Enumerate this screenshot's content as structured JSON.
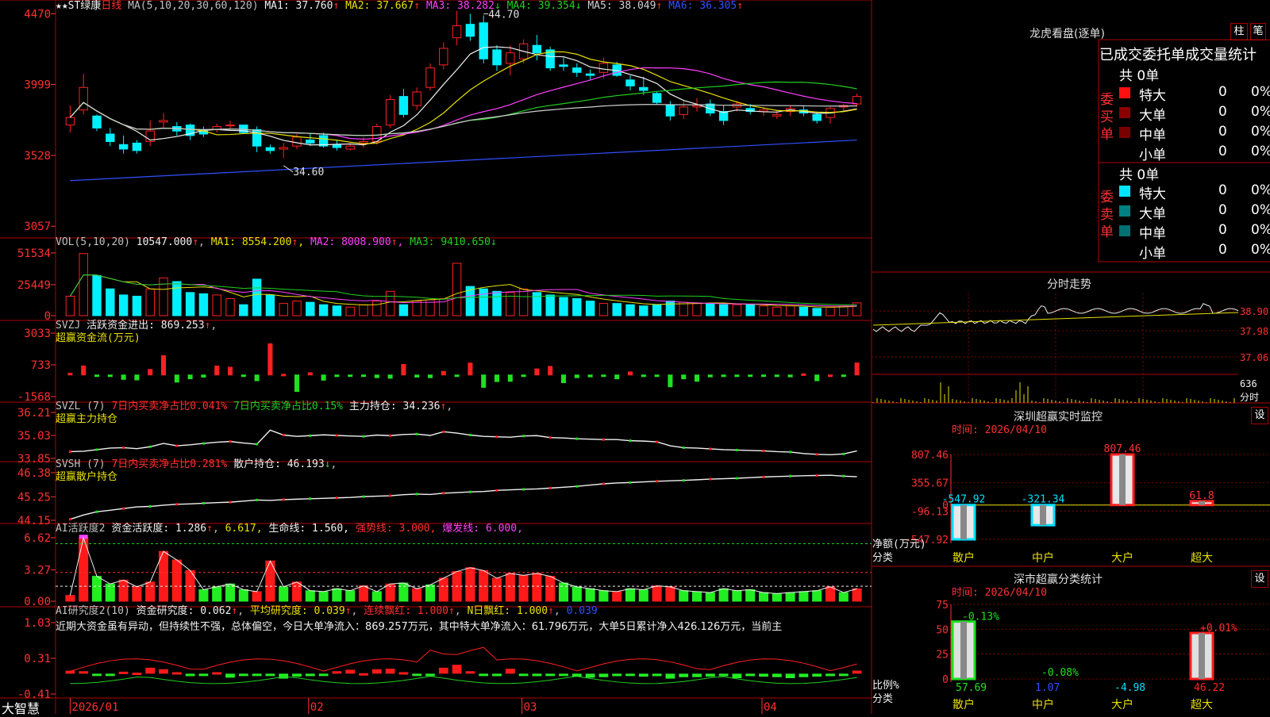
{
  "app": {
    "brand": "大智慧"
  },
  "main": {
    "title_prefix": "★★ST绿康",
    "period": "日线",
    "ma_label": "MA(5,10,20,30,60,120)",
    "ma_values": [
      {
        "name": "MA1:",
        "value": "37.760",
        "arrow": "↑",
        "color": "#f0f0f0"
      },
      {
        "name": "MA2:",
        "value": "37.667",
        "arrow": "↑",
        "color": "#e8e000"
      },
      {
        "name": "MA3:",
        "value": "38.282",
        "arrow": "↓",
        "color": "#ff40ff"
      },
      {
        "name": "MA4:",
        "value": "39.354",
        "arrow": "↓",
        "color": "#20d020"
      },
      {
        "name": "MA5:",
        "value": "38.049",
        "arrow": "↑",
        "color": "#d0d0d0"
      },
      {
        "name": "MA6:",
        "value": "36.305",
        "arrow": "↑",
        "color": "#3050ff"
      }
    ],
    "y_ticks": [
      "4470",
      "3999",
      "3528",
      "3057"
    ],
    "high_label": "44.70",
    "low_label": "34.60"
  },
  "vol": {
    "title": "VOL(5,10,20)",
    "value": "10547.000",
    "ma1": "8554.200",
    "ma2": "8008.900",
    "ma3": "9410.650",
    "y_ticks": [
      "51534",
      "25449",
      "0"
    ]
  },
  "svzj": {
    "title": "SVZJ",
    "label": "活跃资金进出:",
    "value": "869.253",
    "subtitle": "超赢资金流(万元)",
    "y_ticks": [
      "3033",
      "733",
      "-1568"
    ]
  },
  "svzl": {
    "title": "SVZL (7)",
    "t1": "7日内买卖净占比0.041%",
    "t2": "7日内买卖净占比0.15%",
    "t3": "主力持仓: 34.236",
    "subtitle": "超赢主力持仓",
    "y_ticks": [
      "36.21",
      "35.03",
      "33.85"
    ]
  },
  "svsh": {
    "title": "SVSH (7)",
    "t1": "7日内买卖净占比0.281%",
    "t2": "散户持仓: 46.193",
    "subtitle": "超赢散户持仓",
    "y_ticks": [
      "46.38",
      "45.25",
      "44.15"
    ]
  },
  "ai1": {
    "title": "AI活跃度2",
    "t1": "资金活跃度: 1.286",
    "t2": "6.617,",
    "t3": "生命线: 1.560,",
    "t4": "强势线: 3.000,",
    "t5": "爆发线: 6.000,",
    "y_ticks": [
      "6.62",
      "3.27",
      "0.00"
    ]
  },
  "ai2": {
    "title": "AI研究度2(10)",
    "t1": "资金研究度: 0.062",
    "t2": "平均研究度: 0.039",
    "t3": "连续飘红: 1.000",
    "t4": "N日飘红: 1.000",
    "t5": "0.039",
    "comment": "近期大资金虽有异动，但持续性不强，总体偏空，今日大单净流入：869.257万元，其中特大单净流入：61.796万元，大单5日累计净入426.126万元，当前主",
    "y_ticks": [
      "1.03",
      "0.31",
      "-0.41"
    ]
  },
  "x_axis": [
    "2026/01",
    "02",
    "03",
    "04"
  ],
  "right": {
    "lhb_title": "龙虎看盘(逐单)",
    "btn_zhu": "柱",
    "btn_bi": "笔",
    "stats_title": "已成交委托单成交量统计",
    "buy_label": "委买单",
    "sell_label": "委卖单",
    "buy_total": "共 0单",
    "sell_total": "共 0单",
    "rows": [
      {
        "label": "特大",
        "qty": "0",
        "pct": "0%"
      },
      {
        "label": "大单",
        "qty": "0",
        "pct": "0%"
      },
      {
        "label": "中单",
        "qty": "0",
        "pct": "0%"
      },
      {
        "label": "小单",
        "qty": "0",
        "pct": "0%"
      }
    ],
    "intraday_title": "分时走势",
    "intraday_ticks": [
      "38.90",
      "37.98",
      "37.06"
    ],
    "intraday_vol_ticks": [
      "636",
      "分时"
    ],
    "sz_title": "深圳超赢实时监控",
    "sz_btn": "设",
    "sz_time": "时间: 2026/04/10",
    "sz_yticks": [
      "807.46",
      "355.67",
      "0",
      "-96.13",
      "-547.92"
    ],
    "sz_ylabel": "净额(万元)",
    "sz_xlabel": "分类",
    "sz_categories": [
      "散户",
      "中户",
      "大户",
      "超大"
    ],
    "sz_value_labels": [
      "-547.92",
      "-321.34",
      "807.46",
      "61.8"
    ],
    "stat_title": "深市超赢分类统计",
    "stat_btn": "设",
    "stat_time": "时间: 2026/04/10",
    "stat_yticks": [
      "75",
      "50",
      "25",
      "0"
    ],
    "stat_ylabel": "比例%",
    "stat_xlabel": "分类",
    "stat_categories": [
      "散户",
      "中户",
      "大户",
      "超大"
    ],
    "stat_top_labels": [
      "-0.13%",
      "-0.08%",
      "",
      "+0.01%"
    ],
    "stat_bottom_labels": [
      "57.69",
      "1.07",
      "-4.98",
      "46.22"
    ]
  },
  "chart_data": [
    {
      "type": "candlestick",
      "title": "★★ST绿康 日线",
      "ylabel": "",
      "ylim": [
        30.0,
        45.3
      ],
      "note": "prices read from axis (tick 3999 ≈ 40.0)",
      "candles": [
        [
          37.3,
          38.6,
          36.8,
          37.8
        ],
        [
          38.3,
          40.7,
          38.0,
          39.8
        ],
        [
          37.9,
          38.0,
          36.9,
          37.1
        ],
        [
          36.7,
          37.1,
          35.9,
          36.2
        ],
        [
          36.0,
          36.6,
          35.4,
          35.7
        ],
        [
          36.1,
          36.3,
          35.4,
          35.6
        ],
        [
          36.2,
          37.6,
          35.9,
          36.9
        ],
        [
          37.5,
          38.1,
          37.1,
          37.6
        ],
        [
          37.2,
          37.5,
          36.6,
          36.9
        ],
        [
          37.3,
          37.4,
          36.3,
          36.6
        ],
        [
          36.9,
          37.2,
          36.5,
          36.7
        ],
        [
          37.0,
          37.4,
          36.8,
          37.2
        ],
        [
          37.3,
          37.6,
          37.0,
          37.3
        ],
        [
          37.3,
          37.3,
          36.7,
          36.8
        ],
        [
          37.0,
          37.2,
          35.5,
          35.9
        ],
        [
          35.8,
          36.0,
          35.4,
          35.6
        ],
        [
          35.7,
          36.1,
          35.1,
          35.8
        ],
        [
          35.9,
          36.7,
          35.7,
          36.5
        ],
        [
          36.3,
          36.7,
          35.9,
          36.1
        ],
        [
          36.6,
          36.8,
          35.8,
          35.9
        ],
        [
          36.0,
          36.3,
          35.6,
          35.8
        ],
        [
          35.7,
          36.1,
          35.6,
          35.9
        ],
        [
          36.1,
          36.5,
          35.8,
          36.2
        ],
        [
          36.2,
          37.4,
          36.0,
          37.2
        ],
        [
          37.3,
          39.3,
          37.1,
          39.0
        ],
        [
          39.2,
          39.7,
          37.8,
          38.0
        ],
        [
          38.6,
          39.8,
          38.3,
          39.5
        ],
        [
          39.8,
          41.4,
          39.6,
          41.1
        ],
        [
          41.3,
          42.8,
          41.0,
          42.4
        ],
        [
          43.1,
          44.9,
          42.6,
          43.9
        ],
        [
          44.0,
          44.7,
          42.9,
          43.2
        ],
        [
          44.1,
          44.6,
          41.4,
          41.7
        ],
        [
          42.3,
          42.6,
          40.9,
          41.3
        ],
        [
          41.4,
          42.6,
          40.6,
          42.1
        ],
        [
          41.7,
          43.0,
          41.4,
          42.7
        ],
        [
          42.6,
          43.3,
          41.6,
          42.1
        ],
        [
          42.3,
          42.5,
          40.9,
          41.1
        ],
        [
          41.3,
          41.8,
          40.9,
          41.2
        ],
        [
          41.1,
          41.4,
          40.5,
          40.8
        ],
        [
          40.7,
          41.0,
          40.3,
          40.6
        ],
        [
          40.8,
          41.8,
          40.4,
          41.4
        ],
        [
          41.3,
          41.5,
          40.5,
          40.6
        ],
        [
          40.3,
          40.6,
          39.6,
          39.9
        ],
        [
          39.8,
          40.5,
          39.3,
          39.6
        ],
        [
          39.4,
          39.5,
          38.7,
          38.8
        ],
        [
          38.6,
          38.9,
          37.6,
          37.9
        ],
        [
          38.0,
          38.9,
          37.7,
          38.5
        ],
        [
          38.5,
          39.1,
          38.2,
          38.6
        ],
        [
          38.7,
          39.0,
          37.9,
          38.1
        ],
        [
          38.2,
          38.6,
          37.3,
          37.6
        ],
        [
          38.5,
          38.9,
          38.2,
          38.7
        ],
        [
          38.4,
          38.7,
          38.0,
          38.2
        ],
        [
          38.2,
          38.5,
          37.9,
          38.3
        ],
        [
          37.9,
          38.3,
          37.7,
          38.0
        ],
        [
          38.2,
          38.6,
          37.9,
          38.4
        ],
        [
          38.3,
          38.6,
          37.9,
          38.1
        ],
        [
          38.0,
          38.2,
          37.4,
          37.6
        ],
        [
          37.8,
          38.5,
          37.4,
          38.4
        ],
        [
          38.5,
          38.7,
          38.2,
          38.6
        ],
        [
          38.7,
          39.4,
          38.5,
          39.2
        ]
      ],
      "series": [
        {
          "name": "MA1",
          "color": "#f0f0f0"
        },
        {
          "name": "MA2",
          "color": "#e8e000"
        },
        {
          "name": "MA3",
          "color": "#ff40ff"
        },
        {
          "name": "MA4",
          "color": "#20d020"
        },
        {
          "name": "MA5",
          "color": "#d0d0d0"
        },
        {
          "name": "MA6",
          "color": "#3050ff",
          "values_endpoints": [
            33.6,
            36.3
          ]
        }
      ]
    },
    {
      "type": "bar",
      "title": "VOL(5,10,20)",
      "ylim": [
        0,
        56000
      ],
      "values": [
        16000,
        51000,
        33000,
        22000,
        17000,
        16000,
        22000,
        31000,
        28000,
        19000,
        18000,
        17000,
        14000,
        9000,
        30000,
        17000,
        10000,
        12000,
        11000,
        9000,
        8000,
        7000,
        9000,
        12000,
        20000,
        9000,
        12000,
        13000,
        14000,
        43000,
        24000,
        22000,
        20000,
        19000,
        22000,
        19000,
        17000,
        15000,
        14000,
        12000,
        10000,
        10000,
        9000,
        8000,
        9000,
        12000,
        11000,
        10000,
        10000,
        9000,
        9000,
        9000,
        8000,
        7000,
        8000,
        7000,
        6000,
        7000,
        8000,
        10500
      ]
    },
    {
      "type": "bar",
      "title": "SVZJ 活跃资金进出",
      "ylim": [
        -1568,
        3033
      ],
      "values": [
        120,
        650,
        -80,
        -120,
        -320,
        -360,
        400,
        1400,
        -520,
        -280,
        -160,
        650,
        560,
        -40,
        -420,
        2260,
        50,
        -1200,
        160,
        -380,
        -120,
        -80,
        -60,
        -200,
        -240,
        760,
        -160,
        -200,
        260,
        -100,
        860,
        -900,
        -480,
        -460,
        -100,
        440,
        620,
        -560,
        -200,
        -140,
        -80,
        -280,
        220,
        -120,
        -40,
        -860,
        -280,
        -460,
        -140,
        -120,
        -120,
        -100,
        -60,
        -120,
        -140,
        80,
        -420,
        0,
        -40,
        869
      ]
    },
    {
      "type": "line",
      "title": "SVZL 超赢主力持仓",
      "ylim": [
        33.85,
        36.21
      ],
      "values": [
        34.2,
        34.22,
        34.3,
        34.38,
        34.4,
        34.35,
        34.45,
        34.62,
        34.5,
        34.55,
        34.62,
        34.68,
        34.72,
        34.64,
        34.58,
        35.3,
        35.05,
        34.98,
        35.02,
        35.06,
        35.03,
        35.0,
        34.98,
        35.05,
        35.02,
        35.08,
        35.1,
        35.03,
        35.22,
        35.15,
        35.05,
        34.98,
        34.96,
        34.94,
        35.0,
        35.02,
        34.92,
        34.9,
        34.86,
        34.84,
        34.82,
        34.82,
        34.76,
        34.74,
        34.7,
        34.5,
        34.4,
        34.38,
        34.34,
        34.3,
        34.28,
        34.26,
        34.24,
        34.2,
        34.18,
        34.1,
        34.06,
        34.04,
        34.08,
        34.236
      ]
    },
    {
      "type": "line",
      "title": "SVSH 超赢散户持仓",
      "ylim": [
        44.15,
        46.38
      ],
      "values": [
        44.2,
        44.4,
        44.55,
        44.62,
        44.7,
        44.78,
        44.8,
        44.86,
        44.9,
        44.92,
        44.95,
        44.98,
        45.0,
        45.05,
        45.1,
        45.08,
        45.12,
        45.14,
        45.16,
        45.18,
        45.2,
        45.22,
        45.26,
        45.28,
        45.3,
        45.35,
        45.38,
        45.36,
        45.42,
        45.45,
        45.48,
        45.5,
        45.55,
        45.58,
        45.6,
        45.62,
        45.66,
        45.7,
        45.74,
        45.8,
        45.86,
        45.9,
        45.92,
        45.95,
        45.98,
        46.0,
        46.02,
        46.05,
        46.08,
        46.1,
        46.12,
        46.15,
        46.18,
        46.2,
        46.22,
        46.24,
        46.25,
        46.26,
        46.22,
        46.193
      ]
    },
    {
      "type": "bar",
      "title": "AI活跃度2",
      "ylim": [
        0,
        6.62
      ],
      "reference_lines": {
        "生命线": 1.56,
        "强势线": 3.0,
        "爆发线": 6.0
      },
      "values": [
        0.6,
        6.6,
        2.6,
        1.8,
        2.2,
        1.5,
        2.0,
        5.2,
        4.3,
        3.2,
        1.2,
        1.5,
        1.8,
        1.2,
        1.0,
        4.2,
        1.5,
        2.0,
        1.1,
        1.0,
        1.3,
        1.1,
        1.6,
        1.0,
        1.8,
        1.9,
        1.3,
        1.7,
        2.4,
        3.1,
        3.5,
        3.2,
        2.4,
        2.9,
        2.7,
        2.9,
        2.6,
        1.9,
        1.5,
        1.3,
        1.1,
        1.0,
        1.3,
        1.2,
        1.6,
        1.5,
        1.1,
        1.0,
        0.9,
        1.3,
        1.1,
        1.2,
        0.9,
        0.8,
        0.9,
        1.0,
        1.1,
        1.5,
        0.9,
        1.3
      ]
    },
    {
      "type": "bar",
      "title": "AI研究度2(10)",
      "ylim": [
        -0.41,
        1.03
      ],
      "values": [
        0.06,
        0.05,
        -0.02,
        -0.03,
        0.04,
        0.02,
        0.12,
        0.09,
        0.03,
        -0.05,
        -0.03,
        0.03,
        -0.08,
        -0.04,
        -0.02,
        -0.03,
        -0.1,
        -0.06,
        -0.05,
        -0.03,
        0.05,
        0.08,
        0.01,
        0.09,
        0.1,
        0.03,
        -0.03,
        -0.04,
        0.12,
        0.18,
        0.05,
        -0.03,
        -0.05,
        0.1,
        -0.04,
        -0.05,
        -0.02,
        -0.03,
        -0.06,
        -0.08,
        -0.07,
        -0.05,
        -0.04,
        -0.06,
        -0.05,
        -0.1,
        -0.07,
        -0.07,
        -0.06,
        -0.05,
        -0.09,
        -0.05,
        -0.06,
        -0.07,
        -0.09,
        -0.07,
        -0.06,
        -0.05,
        -0.03,
        0.062
      ]
    },
    {
      "type": "bar",
      "title": "深圳超赢实时监控",
      "xlabel": "分类",
      "ylabel": "净额(万元)",
      "categories": [
        "散户",
        "中户",
        "大户",
        "超大"
      ],
      "values": [
        -547.92,
        -321.34,
        807.46,
        61.8
      ],
      "ylim": [
        -547.92,
        807.46
      ]
    },
    {
      "type": "bar",
      "title": "深市超赢分类统计",
      "xlabel": "分类",
      "ylabel": "比例%",
      "categories": [
        "散户",
        "中户",
        "大户",
        "超大"
      ],
      "values": [
        57.69,
        1.07,
        -4.98,
        46.22
      ],
      "change_labels": [
        "-0.13%",
        "-0.08%",
        "",
        "+0.01%"
      ],
      "ylim": [
        0,
        75
      ]
    }
  ]
}
